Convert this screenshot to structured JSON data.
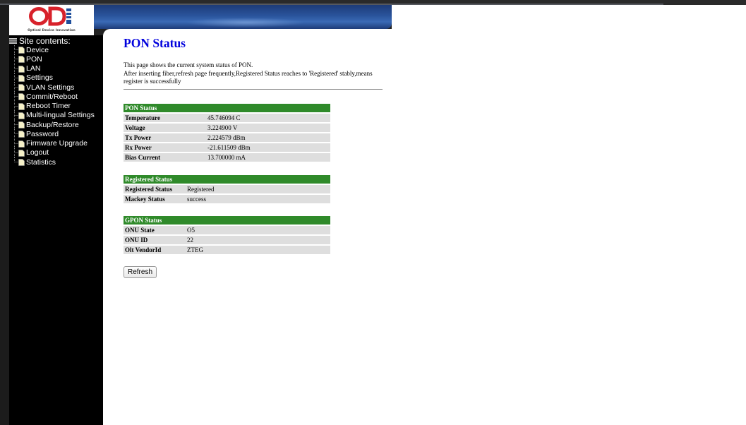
{
  "brand": {
    "logo_text": "ODI",
    "tagline": "Optical Device Innovation"
  },
  "sidebar": {
    "heading": "Site contents:",
    "items": [
      {
        "label": "Device"
      },
      {
        "label": "PON"
      },
      {
        "label": "LAN"
      },
      {
        "label": "Settings"
      },
      {
        "label": "VLAN Settings"
      },
      {
        "label": "Commit/Reboot"
      },
      {
        "label": "Reboot Timer"
      },
      {
        "label": "Multi-lingual Settings"
      },
      {
        "label": "Backup/Restore"
      },
      {
        "label": "Password"
      },
      {
        "label": "Firmware Upgrade"
      },
      {
        "label": "Logout"
      },
      {
        "label": "Statistics"
      }
    ]
  },
  "main": {
    "title": "PON Status",
    "description_line1": "This page shows the current system status of PON.",
    "description_line2": "After inserting fiber,refresh page frequently,Registered Status reaches to 'Registered' stably,means register is successfully",
    "pon_status": {
      "header": "PON Status",
      "rows": [
        {
          "label": "Temperature",
          "value": "45.746094 C"
        },
        {
          "label": "Voltage",
          "value": "3.224900 V"
        },
        {
          "label": "Tx Power",
          "value": "2.224579 dBm"
        },
        {
          "label": "Rx Power",
          "value": "-21.611509 dBm"
        },
        {
          "label": "Bias Current",
          "value": "13.700000 mA"
        }
      ]
    },
    "registered_status": {
      "header": "Registered Status",
      "rows": [
        {
          "label": "Registered Status",
          "value": "Registered"
        },
        {
          "label": "Mackey Status",
          "value": "success"
        }
      ]
    },
    "gpon_status": {
      "header": "GPON Status",
      "rows": [
        {
          "label": "ONU State",
          "value": "O5"
        },
        {
          "label": "ONU ID",
          "value": "22"
        },
        {
          "label": "Olt VendorId",
          "value": "ZTEG"
        }
      ]
    },
    "refresh_label": "Refresh"
  },
  "colors": {
    "section_header": "#2f8a2a",
    "title": "#0000dd",
    "row_bg": "#dedede"
  }
}
